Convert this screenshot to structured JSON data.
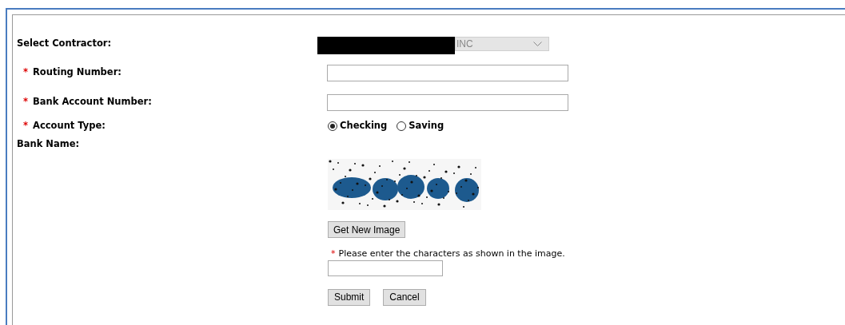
{
  "contractor": {
    "label": "Select Contractor:",
    "value": "INC",
    "redacted": true
  },
  "fields": [
    {
      "label": "Routing Number:",
      "required": "*"
    },
    {
      "label": "Bank Account Number:",
      "required": "*"
    }
  ],
  "account_type": {
    "label": "Account Type:",
    "required": "*",
    "options": [
      {
        "label": "Checking",
        "selected": true
      },
      {
        "label": "Saving",
        "selected": false
      }
    ]
  },
  "bank_name": {
    "label": "Bank Name:"
  },
  "captcha": {
    "kind": "picture",
    "button": "Get New Image",
    "required": "*",
    "prompt": "Please enter the characters as shown in the image."
  },
  "buttons": [
    "Submit",
    "Cancel"
  ]
}
